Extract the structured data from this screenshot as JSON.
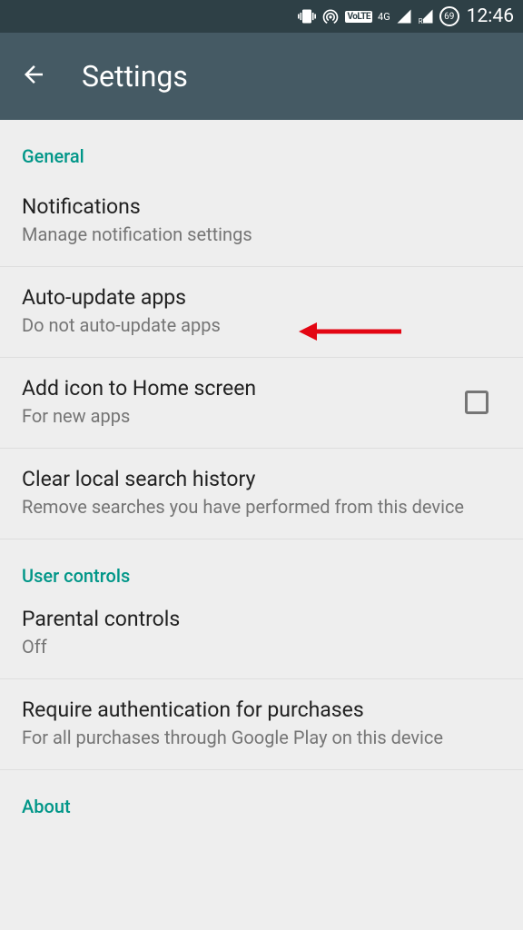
{
  "statusBar": {
    "volte": "VoLTE",
    "network": "4G",
    "battery": "69",
    "time": "12:46"
  },
  "appBar": {
    "title": "Settings"
  },
  "sections": {
    "general": {
      "header": "General",
      "notifications": {
        "title": "Notifications",
        "subtitle": "Manage notification settings"
      },
      "autoUpdate": {
        "title": "Auto-update apps",
        "subtitle": "Do not auto-update apps"
      },
      "addIcon": {
        "title": "Add icon to Home screen",
        "subtitle": "For new apps"
      },
      "clearSearch": {
        "title": "Clear local search history",
        "subtitle": "Remove searches you have performed from this device"
      }
    },
    "userControls": {
      "header": "User controls",
      "parental": {
        "title": "Parental controls",
        "subtitle": "Off"
      },
      "requireAuth": {
        "title": "Require authentication for purchases",
        "subtitle": "For all purchases through Google Play on this device"
      }
    },
    "about": {
      "header": "About"
    }
  }
}
